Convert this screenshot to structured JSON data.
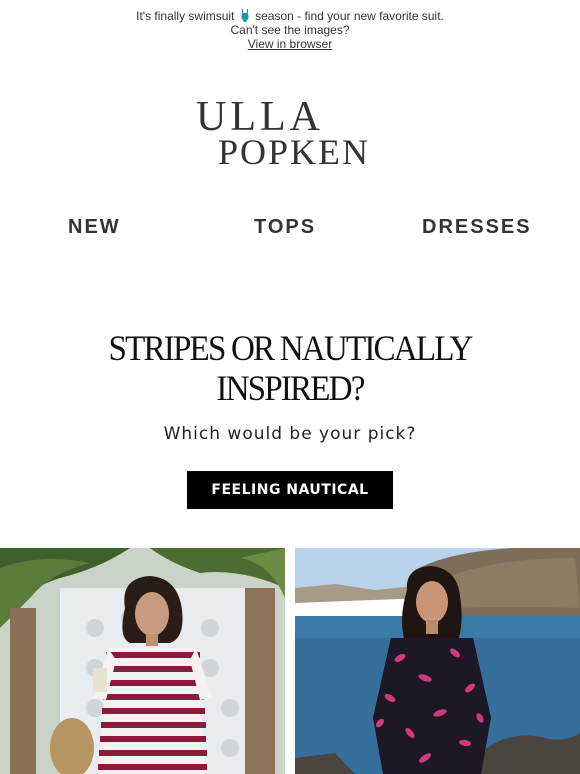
{
  "preheader": {
    "line1_before": "It's finally swimsuit",
    "line1_after": "season - find your new favorite suit.",
    "line2": "Can't see the images?",
    "link": "View in browser"
  },
  "brand": {
    "line1": "ULLA",
    "line2": "POPKEN"
  },
  "nav": {
    "items": [
      "NEW",
      "TOPS",
      "DRESSES"
    ]
  },
  "hero": {
    "headline_line1": "STRIPES OR NAUTICALLY",
    "headline_line2": "INSPIRED?",
    "subtext": "Which would be your pick?",
    "cta": "FEELING NAUTICAL"
  },
  "colors": {
    "cta_bg": "#000000",
    "stripe_red": "#8a1c3b",
    "floral_dark": "#1d1726",
    "floral_pink": "#d03a80"
  }
}
